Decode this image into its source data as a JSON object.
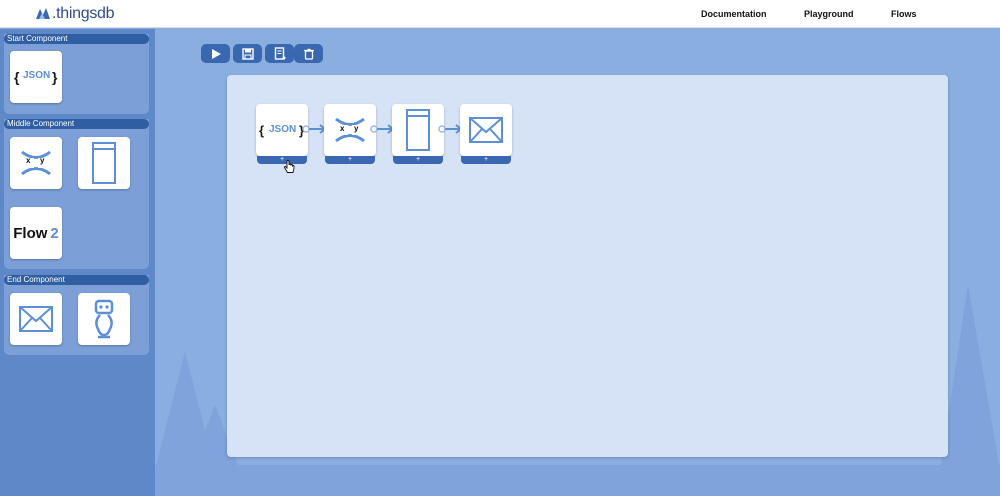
{
  "header": {
    "logo_text": ".thingsdb",
    "nav": [
      "Documentation",
      "Playground",
      "Flows"
    ]
  },
  "sidebar": {
    "sections": [
      {
        "title": "Start Component"
      },
      {
        "title": "Middle Component"
      },
      {
        "title": "End Component"
      }
    ],
    "json_tile_text": "JSON",
    "flow_tile_text": "Flow",
    "flow_tile_number": "2",
    "xy_labels": [
      "x",
      "y"
    ]
  },
  "toolbar": {
    "icons": [
      "play-icon",
      "save-icon",
      "export-icon",
      "trash-icon"
    ]
  },
  "canvas": {
    "nodes": [
      {
        "icon": "json-icon",
        "text": "JSON",
        "footer": "+"
      },
      {
        "icon": "xy-transform-icon",
        "footer": "+"
      },
      {
        "icon": "panel-icon",
        "footer": "+"
      },
      {
        "icon": "mail-icon",
        "footer": "+"
      }
    ]
  },
  "colors": {
    "accent": "#3a68b0",
    "header_bar": "#2f5ea3",
    "background": "#8aaee0",
    "canvas": "#d6e2f5",
    "icon_blue": "#5b8fd6"
  }
}
